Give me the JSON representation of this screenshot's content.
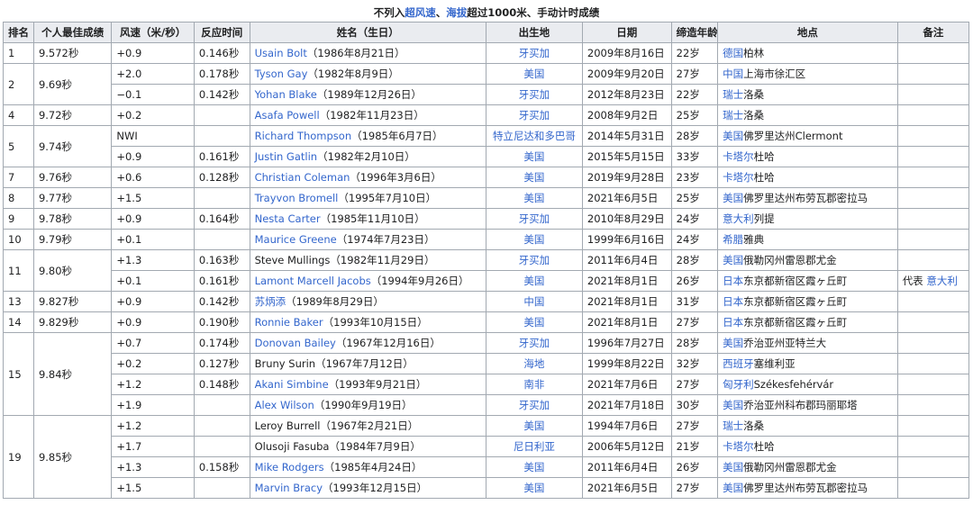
{
  "caption": {
    "prefix": "不列入",
    "link1": "超风速",
    "sep": "、",
    "link2": "海拔",
    "suffix": "超过1000米、手动计时成绩"
  },
  "headers": [
    "排名",
    "个人最佳成绩",
    "风速（米/秒）",
    "反应时间",
    "姓名（生日）",
    "出生地",
    "日期",
    "缔造年龄",
    "地点",
    "备注"
  ],
  "groups": [
    {
      "rank": "1",
      "time": "9.572秒",
      "rows": [
        {
          "wind": "+0.9",
          "react": "0.146秒",
          "name": "Usain Bolt",
          "birth": "（1986年8月21日）",
          "name_link": true,
          "country": "牙买加",
          "country_link": true,
          "date": "2009年8月16日",
          "age": "22岁",
          "loc_country": "德国",
          "loc_city": "柏林",
          "loc_country_link": true,
          "loc_city_link": false,
          "note": ""
        }
      ]
    },
    {
      "rank": "2",
      "time": "9.69秒",
      "rows": [
        {
          "wind": "+2.0",
          "react": "0.178秒",
          "name": "Tyson Gay",
          "birth": "（1982年8月9日）",
          "name_link": true,
          "country": "美国",
          "country_link": true,
          "date": "2009年9月20日",
          "age": "27岁",
          "loc_country": "中国",
          "loc_city": "上海市徐汇区",
          "loc_country_link": true,
          "loc_city_link": false,
          "note": ""
        },
        {
          "wind": "−0.1",
          "react": "0.142秒",
          "name": "Yohan Blake",
          "birth": "（1989年12月26日）",
          "name_link": true,
          "country": "牙买加",
          "country_link": true,
          "date": "2012年8月23日",
          "age": "22岁",
          "loc_country": "瑞士",
          "loc_city": "洛桑",
          "loc_country_link": true,
          "loc_city_link": false,
          "note": ""
        }
      ]
    },
    {
      "rank": "4",
      "time": "9.72秒",
      "rows": [
        {
          "wind": "+0.2",
          "react": "",
          "name": "Asafa Powell",
          "birth": "（1982年11月23日）",
          "name_link": true,
          "country": "牙买加",
          "country_link": true,
          "date": "2008年9月2日",
          "age": "25岁",
          "loc_country": "瑞士",
          "loc_city": "洛桑",
          "loc_country_link": true,
          "loc_city_link": false,
          "note": ""
        }
      ]
    },
    {
      "rank": "5",
      "time": "9.74秒",
      "rows": [
        {
          "wind": "NWI",
          "react": "",
          "name": "Richard Thompson",
          "birth": "（1985年6月7日）",
          "name_link": true,
          "country": "特立尼达和多巴哥",
          "country_link": true,
          "date": "2014年5月31日",
          "age": "28岁",
          "loc_country": "美国",
          "loc_city": "佛罗里达州Clermont",
          "loc_country_link": true,
          "loc_city_link": false,
          "note": ""
        },
        {
          "wind": "+0.9",
          "react": "0.161秒",
          "name": "Justin Gatlin",
          "birth": "（1982年2月10日）",
          "name_link": true,
          "country": "美国",
          "country_link": true,
          "date": "2015年5月15日",
          "age": "33岁",
          "loc_country": "卡塔尔",
          "loc_city": "杜哈",
          "loc_country_link": true,
          "loc_city_link": false,
          "note": ""
        }
      ]
    },
    {
      "rank": "7",
      "time": "9.76秒",
      "rows": [
        {
          "wind": "+0.6",
          "react": "0.128秒",
          "name": "Christian Coleman",
          "birth": "（1996年3月6日）",
          "name_link": true,
          "country": "美国",
          "country_link": true,
          "date": "2019年9月28日",
          "age": "23岁",
          "loc_country": "卡塔尔",
          "loc_city": "杜哈",
          "loc_country_link": true,
          "loc_city_link": false,
          "note": ""
        }
      ]
    },
    {
      "rank": "8",
      "time": "9.77秒",
      "rows": [
        {
          "wind": "+1.5",
          "react": "",
          "name": "Trayvon Bromell",
          "birth": "（1995年7月10日）",
          "name_link": true,
          "country": "美国",
          "country_link": true,
          "date": "2021年6月5日",
          "age": "25岁",
          "loc_country": "美国",
          "loc_city": "佛罗里达州布劳瓦郡密拉马",
          "loc_country_link": true,
          "loc_city_link": false,
          "note": ""
        }
      ]
    },
    {
      "rank": "9",
      "time": "9.78秒",
      "rows": [
        {
          "wind": "+0.9",
          "react": "0.164秒",
          "name": "Nesta Carter",
          "birth": "（1985年11月10日）",
          "name_link": true,
          "country": "牙买加",
          "country_link": true,
          "date": "2010年8月29日",
          "age": "24岁",
          "loc_country": "意大利",
          "loc_city": "列提",
          "loc_country_link": true,
          "loc_city_link": false,
          "note": ""
        }
      ]
    },
    {
      "rank": "10",
      "time": "9.79秒",
      "rows": [
        {
          "wind": "+0.1",
          "react": "",
          "name": "Maurice Greene",
          "birth": "（1974年7月23日）",
          "name_link": true,
          "country": "美国",
          "country_link": true,
          "date": "1999年6月16日",
          "age": "24岁",
          "loc_country": "希腊",
          "loc_city": "雅典",
          "loc_country_link": true,
          "loc_city_link": false,
          "note": ""
        }
      ]
    },
    {
      "rank": "11",
      "time": "9.80秒",
      "rows": [
        {
          "wind": "+1.3",
          "react": "0.163秒",
          "name": "Steve Mullings",
          "birth": "（1982年11月29日）",
          "name_link": false,
          "country": "牙买加",
          "country_link": true,
          "date": "2011年6月4日",
          "age": "28岁",
          "loc_country": "美国",
          "loc_city": "俄勒冈州雷恩郡尤金",
          "loc_country_link": true,
          "loc_city_link": false,
          "note": ""
        },
        {
          "wind": "+0.1",
          "react": "0.161秒",
          "name": "Lamont Marcell Jacobs",
          "birth": "（1994年9月26日）",
          "name_link": true,
          "country": "美国",
          "country_link": true,
          "date": "2021年8月1日",
          "age": "26岁",
          "loc_country": "日本",
          "loc_city": "东京都新宿区霞ヶ丘町",
          "loc_country_link": true,
          "loc_city_link": false,
          "note_prefix": "代表 ",
          "note_link": "意大利"
        }
      ]
    },
    {
      "rank": "13",
      "time": "9.827秒",
      "rows": [
        {
          "wind": "+0.9",
          "react": "0.142秒",
          "name": "苏炳添",
          "birth": "（1989年8月29日）",
          "name_link": true,
          "country": "中国",
          "country_link": true,
          "date": "2021年8月1日",
          "age": "31岁",
          "loc_country": "日本",
          "loc_city": "东京都新宿区霞ヶ丘町",
          "loc_country_link": true,
          "loc_city_link": false,
          "note": ""
        }
      ]
    },
    {
      "rank": "14",
      "time": "9.829秒",
      "rows": [
        {
          "wind": "+0.9",
          "react": "0.190秒",
          "name": "Ronnie Baker",
          "birth": "（1993年10月15日）",
          "name_link": true,
          "country": "美国",
          "country_link": true,
          "date": "2021年8月1日",
          "age": "27岁",
          "loc_country": "日本",
          "loc_city": "东京都新宿区霞ヶ丘町",
          "loc_country_link": true,
          "loc_city_link": false,
          "note": ""
        }
      ]
    },
    {
      "rank": "15",
      "time": "9.84秒",
      "rows": [
        {
          "wind": "+0.7",
          "react": "0.174秒",
          "name": "Donovan Bailey",
          "birth": "（1967年12月16日）",
          "name_link": true,
          "country": "牙买加",
          "country_link": true,
          "date": "1996年7月27日",
          "age": "28岁",
          "loc_country": "美国",
          "loc_city": "乔治亚州亚特兰大",
          "loc_country_link": true,
          "loc_city_link": false,
          "note": ""
        },
        {
          "wind": "+0.2",
          "react": "0.127秒",
          "name": "Bruny Surin",
          "birth": "（1967年7月12日）",
          "name_link": false,
          "country": "海地",
          "country_link": true,
          "date": "1999年8月22日",
          "age": "32岁",
          "loc_country": "西班牙",
          "loc_city": "塞维利亚",
          "loc_country_link": true,
          "loc_city_link": false,
          "note": ""
        },
        {
          "wind": "+1.2",
          "react": "0.148秒",
          "name": "Akani Simbine",
          "birth": "（1993年9月21日）",
          "name_link": true,
          "country": "南非",
          "country_link": true,
          "date": "2021年7月6日",
          "age": "27岁",
          "loc_country": "匈牙利",
          "loc_city": "Székesfehérvár",
          "loc_country_link": true,
          "loc_city_link": false,
          "note": ""
        },
        {
          "wind": "+1.9",
          "react": "",
          "name": "Alex Wilson",
          "birth": "（1990年9月19日）",
          "name_link": true,
          "country": "牙买加",
          "country_link": true,
          "date": "2021年7月18日",
          "age": "30岁",
          "loc_country": "美国",
          "loc_city": "乔治亚州科布郡玛丽耶塔",
          "loc_country_link": true,
          "loc_city_link": false,
          "note": ""
        }
      ]
    },
    {
      "rank": "19",
      "time": "9.85秒",
      "rows": [
        {
          "wind": "+1.2",
          "react": "",
          "name": "Leroy Burrell",
          "birth": "（1967年2月21日）",
          "name_link": false,
          "country": "美国",
          "country_link": true,
          "date": "1994年7月6日",
          "age": "27岁",
          "loc_country": "瑞士",
          "loc_city": "洛桑",
          "loc_country_link": true,
          "loc_city_link": false,
          "note": ""
        },
        {
          "wind": "+1.7",
          "react": "",
          "name": "Olusoji Fasuba",
          "birth": "（1984年7月9日）",
          "name_link": false,
          "country": "尼日利亚",
          "country_link": true,
          "date": "2006年5月12日",
          "age": "21岁",
          "loc_country": "卡塔尔",
          "loc_city": "杜哈",
          "loc_country_link": true,
          "loc_city_link": false,
          "note": ""
        },
        {
          "wind": "+1.3",
          "react": "0.158秒",
          "name": "Mike Rodgers",
          "birth": "（1985年4月24日）",
          "name_link": true,
          "country": "美国",
          "country_link": true,
          "date": "2011年6月4日",
          "age": "26岁",
          "loc_country": "美国",
          "loc_city": "俄勒冈州雷恩郡尤金",
          "loc_country_link": true,
          "loc_city_link": false,
          "note": ""
        },
        {
          "wind": "+1.5",
          "react": "",
          "name": "Marvin Bracy",
          "birth": "（1993年12月15日）",
          "name_link": true,
          "country": "美国",
          "country_link": true,
          "date": "2021年6月5日",
          "age": "27岁",
          "loc_country": "美国",
          "loc_city": "佛罗里达州布劳瓦郡密拉马",
          "loc_country_link": true,
          "loc_city_link": false,
          "note": ""
        }
      ]
    }
  ]
}
